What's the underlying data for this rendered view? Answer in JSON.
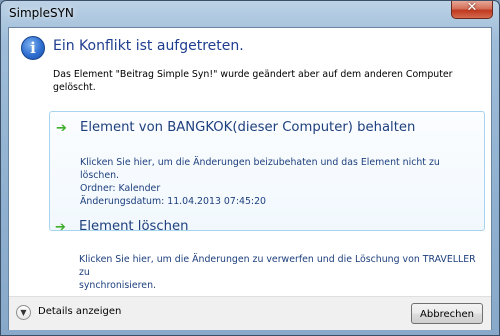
{
  "window": {
    "title": "SimpleSYN",
    "close_symbol": "✕"
  },
  "dialog": {
    "icon": "information-icon",
    "icon_glyph": "i",
    "main_instruction": "Ein Konflikt ist aufgetreten.",
    "content": "Das Element \"Beitrag Simple Syn!\" wurde geändert aber auf dem anderen Computer gelöscht."
  },
  "options": [
    {
      "title": "Element von BANGKOK(dieser Computer) behalten",
      "description_lines": [
        "Klicken Sie hier, um die Änderungen beizubehaten und das Element nicht zu löschen.",
        "Ordner: Kalender",
        "Änderungsdatum: 11.04.2013 07:45:20"
      ]
    },
    {
      "title": "Element löschen",
      "description_lines": [
        "Klicken Sie hier, um die Änderungen zu verwerfen und die Löschung von TRAVELLER zu",
        "synchronisieren."
      ]
    }
  ],
  "footer": {
    "details_label": "Details anzeigen",
    "cancel_label": "Abbrechen"
  },
  "colors": {
    "accent_text": "#1d3f7d",
    "heading": "#1e3d8f",
    "arrow": "#3fae2a"
  }
}
